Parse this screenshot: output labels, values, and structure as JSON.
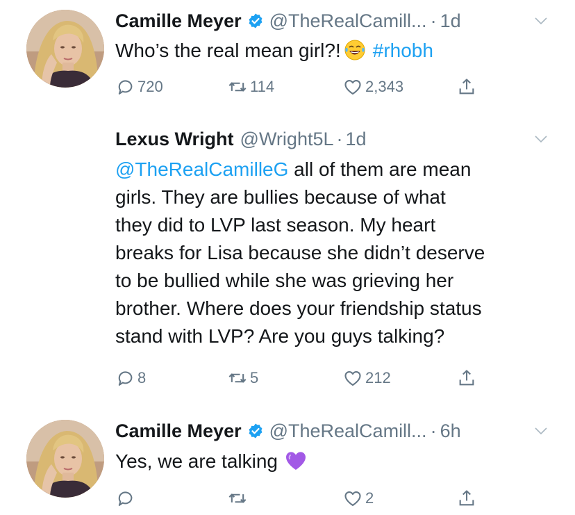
{
  "tweets": [
    {
      "name": "Camille Meyer",
      "verified": true,
      "handle": "@TheRealCamill...",
      "dot": "·",
      "time": "1d",
      "text_parts": [
        "Who’s the real mean girl?!",
        "#rhobh"
      ],
      "emoji": "tears-of-joy-emoji",
      "replies": "720",
      "retweets": "114",
      "likes": "2,343"
    },
    {
      "name": "Lexus Wright",
      "verified": false,
      "handle": "@Wright5L",
      "dot": "·",
      "time": "1d",
      "mention": "@TheRealCamilleG",
      "lines": [
        " all of them are mean",
        "girls. They are bullies because of what",
        "they did to LVP last season. My heart",
        "breaks for Lisa because she didn’t deserve",
        "to be bullied while she was grieving her",
        "brother. Where does your friendship status",
        "stand with LVP? Are you guys talking?"
      ],
      "replies": "8",
      "retweets": "5",
      "likes": "212"
    },
    {
      "name": "Camille Meyer",
      "verified": true,
      "handle": "@TheRealCamill...",
      "dot": "·",
      "time": "6h",
      "text": "Yes, we are talking",
      "emoji": "purple-heart-emoji",
      "replies": "",
      "retweets": "",
      "likes": "2"
    }
  ],
  "colors": {
    "text": "#14171a",
    "secondary": "#657786",
    "link": "#1da1f2",
    "verified": "#1da1f2"
  },
  "icons": [
    "reply-icon",
    "retweet-icon",
    "like-icon",
    "share-icon",
    "verified-badge-icon",
    "chevron-down-icon"
  ]
}
